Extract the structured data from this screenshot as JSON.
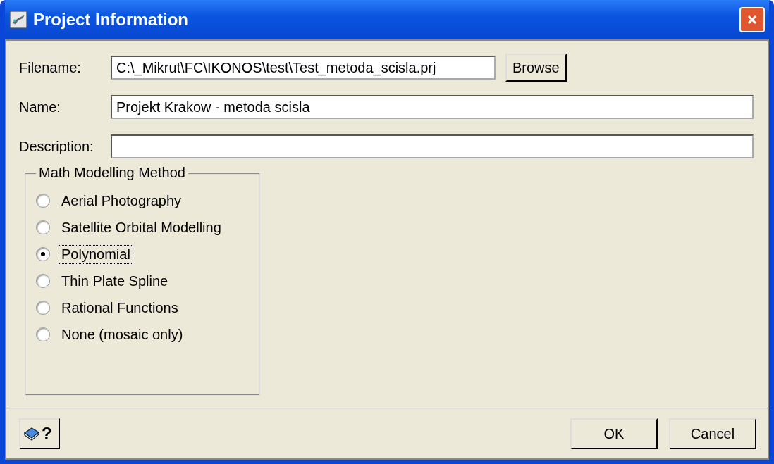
{
  "window": {
    "title": "Project Information"
  },
  "fields": [
    {
      "label": "Filename:",
      "value": "C:\\_Mikrut\\FC\\IKONOS\\test\\Test_metoda_scisla.prj",
      "button": "Browse"
    },
    {
      "label": "Name:",
      "value": "Projekt Krakow - metoda scisla"
    },
    {
      "label": "Description:"
    }
  ],
  "method_group": {
    "title": "Math Modelling Method",
    "options": [
      {
        "label": "Aerial Photography",
        "selected": false
      },
      {
        "label": "Satellite Orbital Modelling",
        "selected": false
      },
      {
        "label": "Polynomial",
        "selected": true
      },
      {
        "label": "Thin Plate Spline",
        "selected": false
      },
      {
        "label": "Rational Functions",
        "selected": false
      },
      {
        "label": "None (mosaic only)",
        "selected": false
      }
    ]
  },
  "help_button": {
    "label": "?"
  },
  "buttons": [
    "OK",
    "Cancel"
  ]
}
